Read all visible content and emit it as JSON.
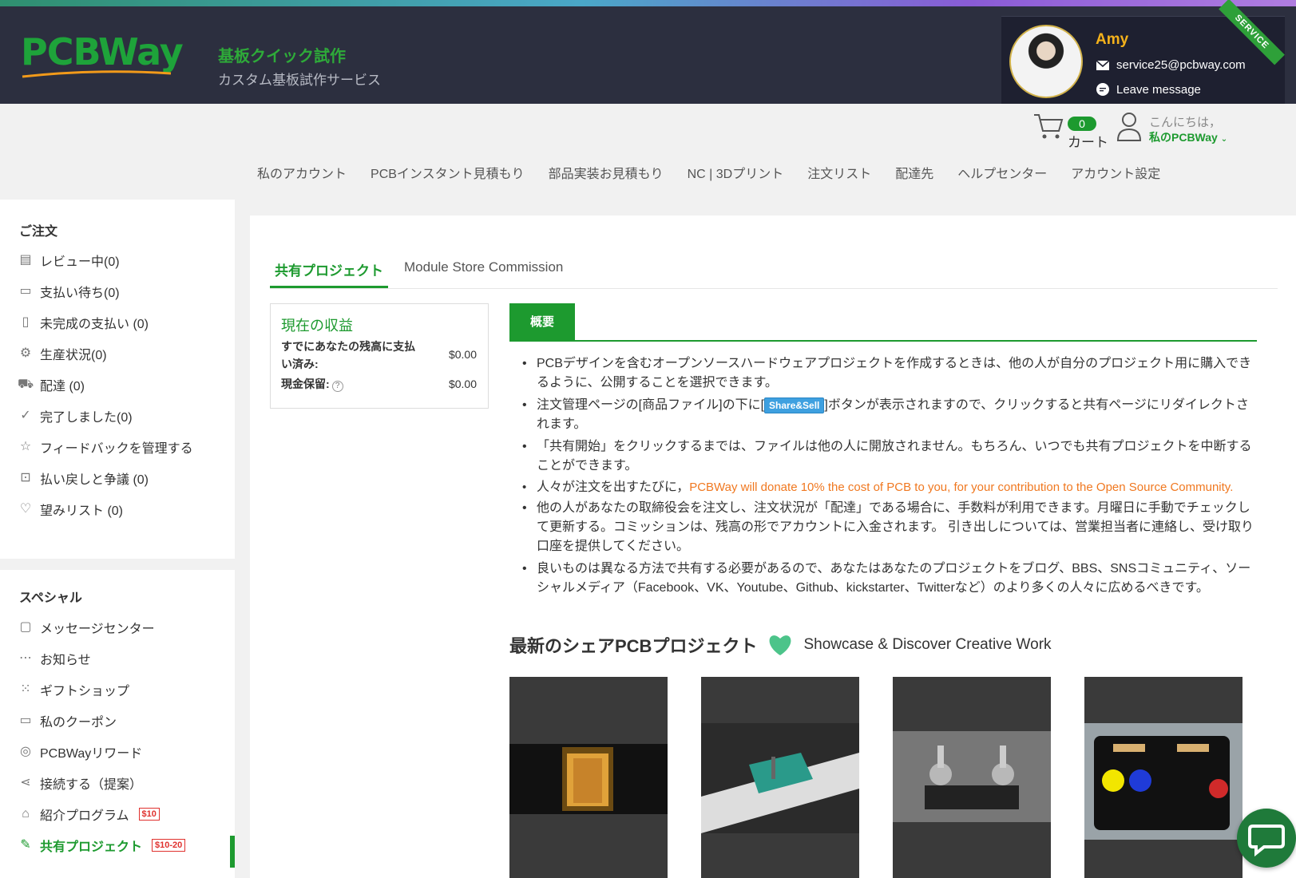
{
  "brand": {
    "logo": "PCBWay",
    "tagline_title": "基板クイック試作",
    "tagline_sub": "カスタム基板試作サービス"
  },
  "service": {
    "name": "Amy",
    "email": "service25@pcbway.com",
    "message": "Leave message",
    "ribbon": "SERVICE"
  },
  "user": {
    "cart_count": "0",
    "cart_label": "カート",
    "greeting": "こんにちは，",
    "my_account": "私のPCBWay"
  },
  "nav": [
    "私のアカウント",
    "PCBインスタント見積もり",
    "部品実装お見積もり",
    "NC | 3Dプリント",
    "注文リスト",
    "配達先",
    "ヘルプセンター",
    "アカウント設定"
  ],
  "sidebar": {
    "orders_title": "ご注文",
    "orders": [
      {
        "label": "レビュー中(0)",
        "icon": "review-icon"
      },
      {
        "label": "支払い待ち(0)",
        "icon": "card-icon"
      },
      {
        "label": "未完成の支払い (0)",
        "icon": "document-icon"
      },
      {
        "label": "生産状況(0)",
        "icon": "gear-icon"
      },
      {
        "label": "配達 (0)",
        "icon": "truck-icon"
      },
      {
        "label": "完了しました(0)",
        "icon": "check-circle-icon"
      },
      {
        "label": "フィードバックを管理する",
        "icon": "star-icon"
      },
      {
        "label": "払い戻しと争議 (0)",
        "icon": "box-icon"
      },
      {
        "label": "望みリスト (0)",
        "icon": "heart-icon"
      }
    ],
    "special_title": "スペシャル",
    "special": [
      {
        "label": "メッセージセンター",
        "icon": "message-icon"
      },
      {
        "label": "お知らせ",
        "icon": "notice-icon"
      },
      {
        "label": "ギフトショップ",
        "icon": "grid-icon"
      },
      {
        "label": "私のクーポン",
        "icon": "coupon-icon"
      },
      {
        "label": "PCBWayリワード",
        "icon": "medal-icon"
      },
      {
        "label": "接続する（提案）",
        "icon": "share-icon"
      },
      {
        "label": "紹介プログラム",
        "icon": "gift-icon",
        "tag": "$10"
      },
      {
        "label": "共有プロジェクト",
        "icon": "project-icon",
        "tag": "$10-20"
      }
    ]
  },
  "tabs": [
    "共有プロジェクト",
    "Module Store Commission"
  ],
  "earnings": {
    "title": "現在の収益",
    "paid_label": "すでにあなたの残高に支払い済み:",
    "paid_value": "$0.00",
    "hold_label": "現金保留:",
    "hold_value": "$0.00"
  },
  "overview": {
    "tab": "概要",
    "b1": "PCBデザインを含むオープンソースハードウェアプロジェクトを作成するときは、他の人が自分のプロジェクト用に購入できるように、公開することを選択できます。",
    "b2_pre": "注文管理ページの[商品ファイル]の下に[",
    "b2_btn": "Share&Sell",
    "b2_post": "]ボタンが表示されますので、クリックすると共有ページにリダイレクトされます。",
    "b3": "「共有開始」をクリックするまでは、ファイルは他の人に開放されません。もちろん、いつでも共有プロジェクトを中断することができます。",
    "b4_pre": "人々が注文を出すたびに，",
    "b4_orange": "PCBWay will donate 10% the cost of PCB to you, for your contribution to the Open Source Community.",
    "b5": "他の人があなたの取締役会を注文し、注文状況が「配達」である場合に、手数料が利用できます。月曜日に手動でチェックして更新する。コミッションは、残高の形でアカウントに入金されます。 引き出しについては、営業担当者に連絡し、受け取り口座を提供してください。",
    "b6": "良いものは異なる方法で共有する必要があるので、あなたはあなたのプロジェクトをブログ、BBS、SNSコミュニティ、ソーシャルメディア（Facebook、VK、Youtube、Github、kickstarter、Twitterなど）のより多くの人々に広めるべきです。"
  },
  "latest": {
    "title": "最新のシェアPCBプロジェクト",
    "subtitle": "Showcase & Discover Creative Work"
  },
  "cards": [
    {
      "alt": "glowing enclosure"
    },
    {
      "alt": "breadboard socket"
    },
    {
      "alt": "potentiometer board"
    },
    {
      "alt": "LED flasher board"
    }
  ],
  "colors": {
    "accent": "#1d9a2f",
    "header": "#2c2f3f",
    "orange": "#f07820"
  }
}
